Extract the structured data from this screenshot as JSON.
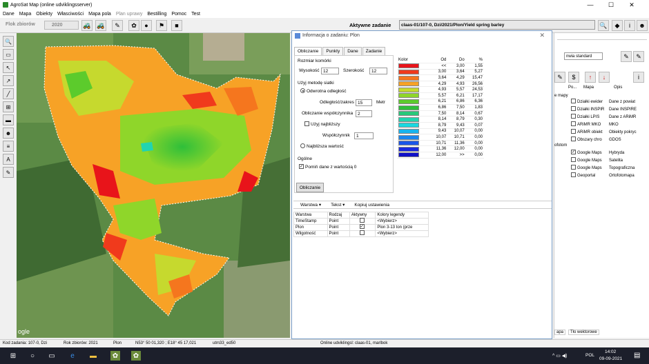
{
  "window": {
    "title": "AgroSat Map (online udviklingsserver)",
    "controls": [
      "—",
      "☐",
      "✕"
    ]
  },
  "menu": [
    {
      "label": "Dane",
      "enabled": true
    },
    {
      "label": "Mapa",
      "enabled": true
    },
    {
      "label": "Obiekty",
      "enabled": true
    },
    {
      "label": "Własciwości",
      "enabled": true
    },
    {
      "label": "Mapa pola",
      "enabled": true
    },
    {
      "label": "Plan uprawy",
      "enabled": false
    },
    {
      "label": "Bestilling",
      "enabled": true
    },
    {
      "label": "Pomoc",
      "enabled": true
    },
    {
      "label": "Test",
      "enabled": true
    }
  ],
  "toolbar": {
    "flok_label": "Flok zbiorów",
    "year_value": "2020",
    "active_task_label": "Aktywne zadanie",
    "active_task_value": "claas-01/107-0, Dzi/2021/Plon/Yield spring barley"
  },
  "dialog": {
    "title": "Informacja o zadaniu: Plon",
    "tabs": [
      "Obliczanie",
      "Punkty",
      "Dane",
      "Zadanie"
    ],
    "cell_size_label": "Rozmiar komórki",
    "height_label": "Wysokość",
    "height_value": "12",
    "width_label": "Szerokość",
    "width_value": "12",
    "method_label": "Użyj metodę siatki",
    "inverse_distance_label": "Odwrotna odległość",
    "distance_range_label": "Odległość/zakres",
    "distance_range_value": "15",
    "meters_label": "Metr",
    "coef_label": "Obliczanie współczynnika",
    "coef_value": "2",
    "nearest_use_label": "Użyj najbliższy",
    "factor_label": "Współczynnik",
    "factor_value": "1",
    "nearest_value_label": "Najbliższa wartość",
    "general_label": "Ogólne",
    "skip_zero_label": "Pomiń dane z wartością 0",
    "calc_button": "Obliczanie",
    "legend_headers": [
      "Kolor",
      "Od",
      "Do",
      "%"
    ],
    "legend_rows": [
      {
        "color": "#e8141a",
        "from": "<<",
        "to": "3,00",
        "pct": "1,55"
      },
      {
        "color": "#f03a1c",
        "from": "3,00",
        "to": "3,64",
        "pct": "5,27"
      },
      {
        "color": "#f5761e",
        "from": "3,64",
        "to": "4,29",
        "pct": "15,47"
      },
      {
        "color": "#f7a226",
        "from": "4,29",
        "to": "4,93",
        "pct": "26,56"
      },
      {
        "color": "#c6d92e",
        "from": "4,93",
        "to": "5,57",
        "pct": "24,53"
      },
      {
        "color": "#8fd62a",
        "from": "5,57",
        "to": "6,21",
        "pct": "17,17"
      },
      {
        "color": "#5ccb2c",
        "from": "6,21",
        "to": "6,86",
        "pct": "6,36"
      },
      {
        "color": "#2fbf3a",
        "from": "6,86",
        "to": "7,50",
        "pct": "1,83"
      },
      {
        "color": "#28c87a",
        "from": "7,50",
        "to": "8,14",
        "pct": "0,67"
      },
      {
        "color": "#22d4b0",
        "from": "8,14",
        "to": "8,79",
        "pct": "0,30"
      },
      {
        "color": "#1ad8e0",
        "from": "8,79",
        "to": "9,43",
        "pct": "0,07"
      },
      {
        "color": "#18b4ee",
        "from": "9,43",
        "to": "10,07",
        "pct": "0,00"
      },
      {
        "color": "#1a86ee",
        "from": "10,07",
        "to": "10,71",
        "pct": "0,00"
      },
      {
        "color": "#1b56e8",
        "from": "10,71",
        "to": "11,36",
        "pct": "0,00"
      },
      {
        "color": "#1a2ae0",
        "from": "11,36",
        "to": "12,00",
        "pct": "0,00"
      },
      {
        "color": "#1010c8",
        "from": "12,00",
        "to": ">>",
        "pct": "0,00"
      }
    ],
    "layer_toolbar": [
      "Warstwa ▾",
      "Tekst ▾",
      "Kopiuj ustawienia"
    ],
    "layer_headers": [
      "Warstwa",
      "Rodzaj",
      "Aktywny",
      "Kolory legendy"
    ],
    "layer_rows": [
      {
        "name": "TimeStamp",
        "type": "Point",
        "active": false,
        "colors": "<Wybierz>"
      },
      {
        "name": "Plon",
        "type": "Point",
        "active": true,
        "colors": "Plon 3-13 ton (prze"
      },
      {
        "name": "Wilgotność",
        "type": "Point",
        "active": false,
        "colors": "<Wybierz>"
      }
    ]
  },
  "right_panel": {
    "dropdown_value": "nwia standard",
    "col_headers": [
      "Po...",
      "Mapa",
      "Opis"
    ],
    "side_label_1": "e mapy",
    "side_label_2": "ofotom",
    "layers": [
      {
        "map": "Działki ewider",
        "desc": "Dane z powiat",
        "checked": false
      },
      {
        "map": "Działki INSPIR",
        "desc": "Dane INSPIRE",
        "checked": false
      },
      {
        "map": "Działki LPIS",
        "desc": "Dane z ARiMR",
        "checked": false
      },
      {
        "map": "ARiMR MKO",
        "desc": "MKO",
        "checked": false
      },
      {
        "map": "ARiMR obiekt",
        "desc": "Obiekty pokryc",
        "checked": false
      },
      {
        "map": "Obszary chro",
        "desc": "GDOS",
        "checked": false
      },
      {
        "map": "Google Maps",
        "desc": "Hybryda",
        "checked": true
      },
      {
        "map": "Google Maps",
        "desc": "Satelita",
        "checked": false
      },
      {
        "map": "Google Maps",
        "desc": "Topograficzna",
        "checked": false
      },
      {
        "map": "Geoportal",
        "desc": "Ortofotomapa",
        "checked": false
      }
    ],
    "bottom_tabs": [
      "apa",
      "Tło wektorowe"
    ]
  },
  "map": {
    "attribution": "ogle"
  },
  "status": {
    "task_code": "Kod zadania: 107-0, Dzi",
    "year": "Rok zbiorów: 2021",
    "layer": "Plon",
    "coords": "N53° 50 01,320 ; E18° 45 17,021",
    "projection": "utm33_ed50",
    "server": "Online udviklingsl: claas-01, marlbok"
  },
  "taskbar": {
    "lang": "POL",
    "time": "14:02",
    "date": "09-09-2021"
  },
  "colors": {
    "dialog_border": "#7a9ec8",
    "taskbar": "#1c1f2b"
  }
}
